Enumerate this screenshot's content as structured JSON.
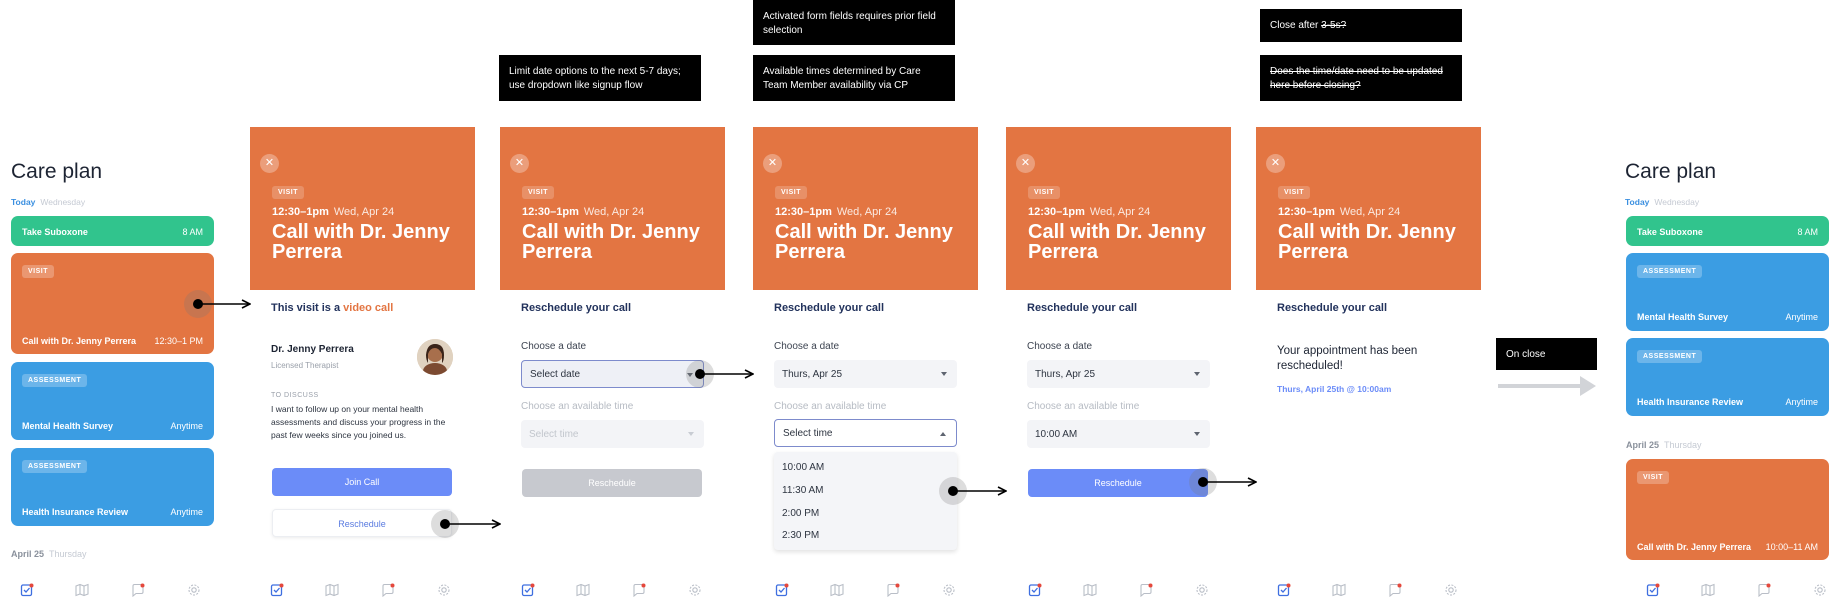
{
  "notes": {
    "limit_dates": "Limit date options to the next 5-7 days; use dropdown like signup flow",
    "activated_fields": "Activated form fields requires prior field selection",
    "available_times": "Available times determined by Care Team Member availability via CP",
    "close_after_prefix": "Close after ",
    "close_after_strike": "3-5s?",
    "update_question": "Does the time/date need to be updated here before closing?",
    "on_close": "On close"
  },
  "care_plan_before": {
    "title": "Care plan",
    "tab_today": "Today",
    "tab_day": "Wednesday",
    "items": [
      {
        "title": "Take Suboxone",
        "right": "8 AM"
      },
      {
        "tag": "VISIT",
        "title": "Call with Dr. Jenny Perrera",
        "right": "12:30–1 PM"
      },
      {
        "tag": "ASSESSMENT",
        "title": "Mental Health Survey",
        "right": "Anytime"
      },
      {
        "tag": "ASSESSMENT",
        "title": "Health Insurance Review",
        "right": "Anytime"
      }
    ],
    "next_date": "April 25",
    "next_day": "Thursday"
  },
  "care_plan_after": {
    "title": "Care plan",
    "tab_today": "Today",
    "tab_day": "Wednesday",
    "items": [
      {
        "title": "Take Suboxone",
        "right": "8 AM"
      },
      {
        "tag": "ASSESSMENT",
        "title": "Mental Health Survey",
        "right": "Anytime"
      },
      {
        "tag": "ASSESSMENT",
        "title": "Health Insurance Review",
        "right": "Anytime"
      },
      {
        "tag": "VISIT",
        "title": "Call with Dr. Jenny Perrera",
        "right": "10:00–11 AM"
      }
    ],
    "next_date": "April 25",
    "next_day": "Thursday"
  },
  "visit": {
    "tag": "VISIT",
    "time": "12:30–1pm",
    "date": "Wed, Apr 24",
    "name": "Call with Dr. Jenny Perrera",
    "close_glyph": "✕"
  },
  "details": {
    "intro": "This visit is a ",
    "intro_accent": "video call",
    "doctor_name": "Dr. Jenny Perrera",
    "doctor_role": "Licensed Therapist",
    "to_discuss_label": "TO DISCUSS",
    "to_discuss_text": "I want to follow up on your mental health assessments and discuss your progress in the past few weeks since you joined us.",
    "join_label": "Join Call",
    "reschedule_label": "Reschedule"
  },
  "reschedule": {
    "title": "Reschedule your call",
    "date_label": "Choose a date",
    "time_label": "Choose an available time",
    "date_placeholder": "Select date",
    "time_placeholder": "Select time",
    "selected_date": "Thurs, Apr 25",
    "selected_time": "10:00 AM",
    "button_label": "Reschedule",
    "time_options": [
      "10:00 AM",
      "11:30 AM",
      "2:00 PM",
      "2:30 PM"
    ]
  },
  "confirmation": {
    "title": "Reschedule your call",
    "message": "Your appointment has been rescheduled!",
    "when": "Thurs, April 25th @ 10:00am"
  },
  "colors": {
    "orange": "#e37542",
    "green": "#31c48d",
    "blue_card": "#3b9de3",
    "button_blue": "#6b8cf8"
  },
  "icons": [
    "checklist-icon",
    "map-icon",
    "chat-icon",
    "gear-icon"
  ]
}
